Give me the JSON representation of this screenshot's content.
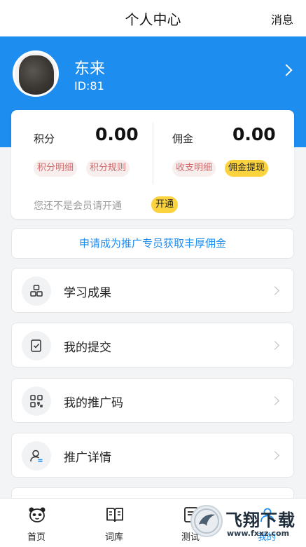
{
  "header": {
    "title": "个人中心",
    "message_label": "消息"
  },
  "profile": {
    "name": "东来",
    "id_text": "ID:81"
  },
  "points": {
    "label": "积分",
    "value": "0.00",
    "detail_tag": "积分明细",
    "rules_tag": "积分规则"
  },
  "commission": {
    "label": "佣金",
    "value": "0.00",
    "detail_tag": "收支明细",
    "withdraw_tag": "佣金提现"
  },
  "membership": {
    "notice": "您还不是会员请开通",
    "open_label": "开通"
  },
  "promo_banner": "申请成为推广专员获取丰厚佣金",
  "menu": [
    {
      "label": "学习成果",
      "icon": "learning-results-icon"
    },
    {
      "label": "我的提交",
      "icon": "submission-icon"
    },
    {
      "label": "我的推广码",
      "icon": "qr-code-icon"
    },
    {
      "label": "推广详情",
      "icon": "user-detail-icon"
    }
  ],
  "tabbar": {
    "items": [
      {
        "label": "首页",
        "icon": "panda-home-icon"
      },
      {
        "label": "词库",
        "icon": "book-icon"
      },
      {
        "label": "测试",
        "icon": "test-icon"
      },
      {
        "label": "我的",
        "icon": "profile-icon"
      }
    ]
  },
  "watermark": {
    "text": "飞翔下载",
    "url": "www.fxxz.com"
  },
  "colors": {
    "primary": "#1d8df0",
    "accent_yellow": "#fbd33e",
    "tag_red": "#d16a6a"
  }
}
